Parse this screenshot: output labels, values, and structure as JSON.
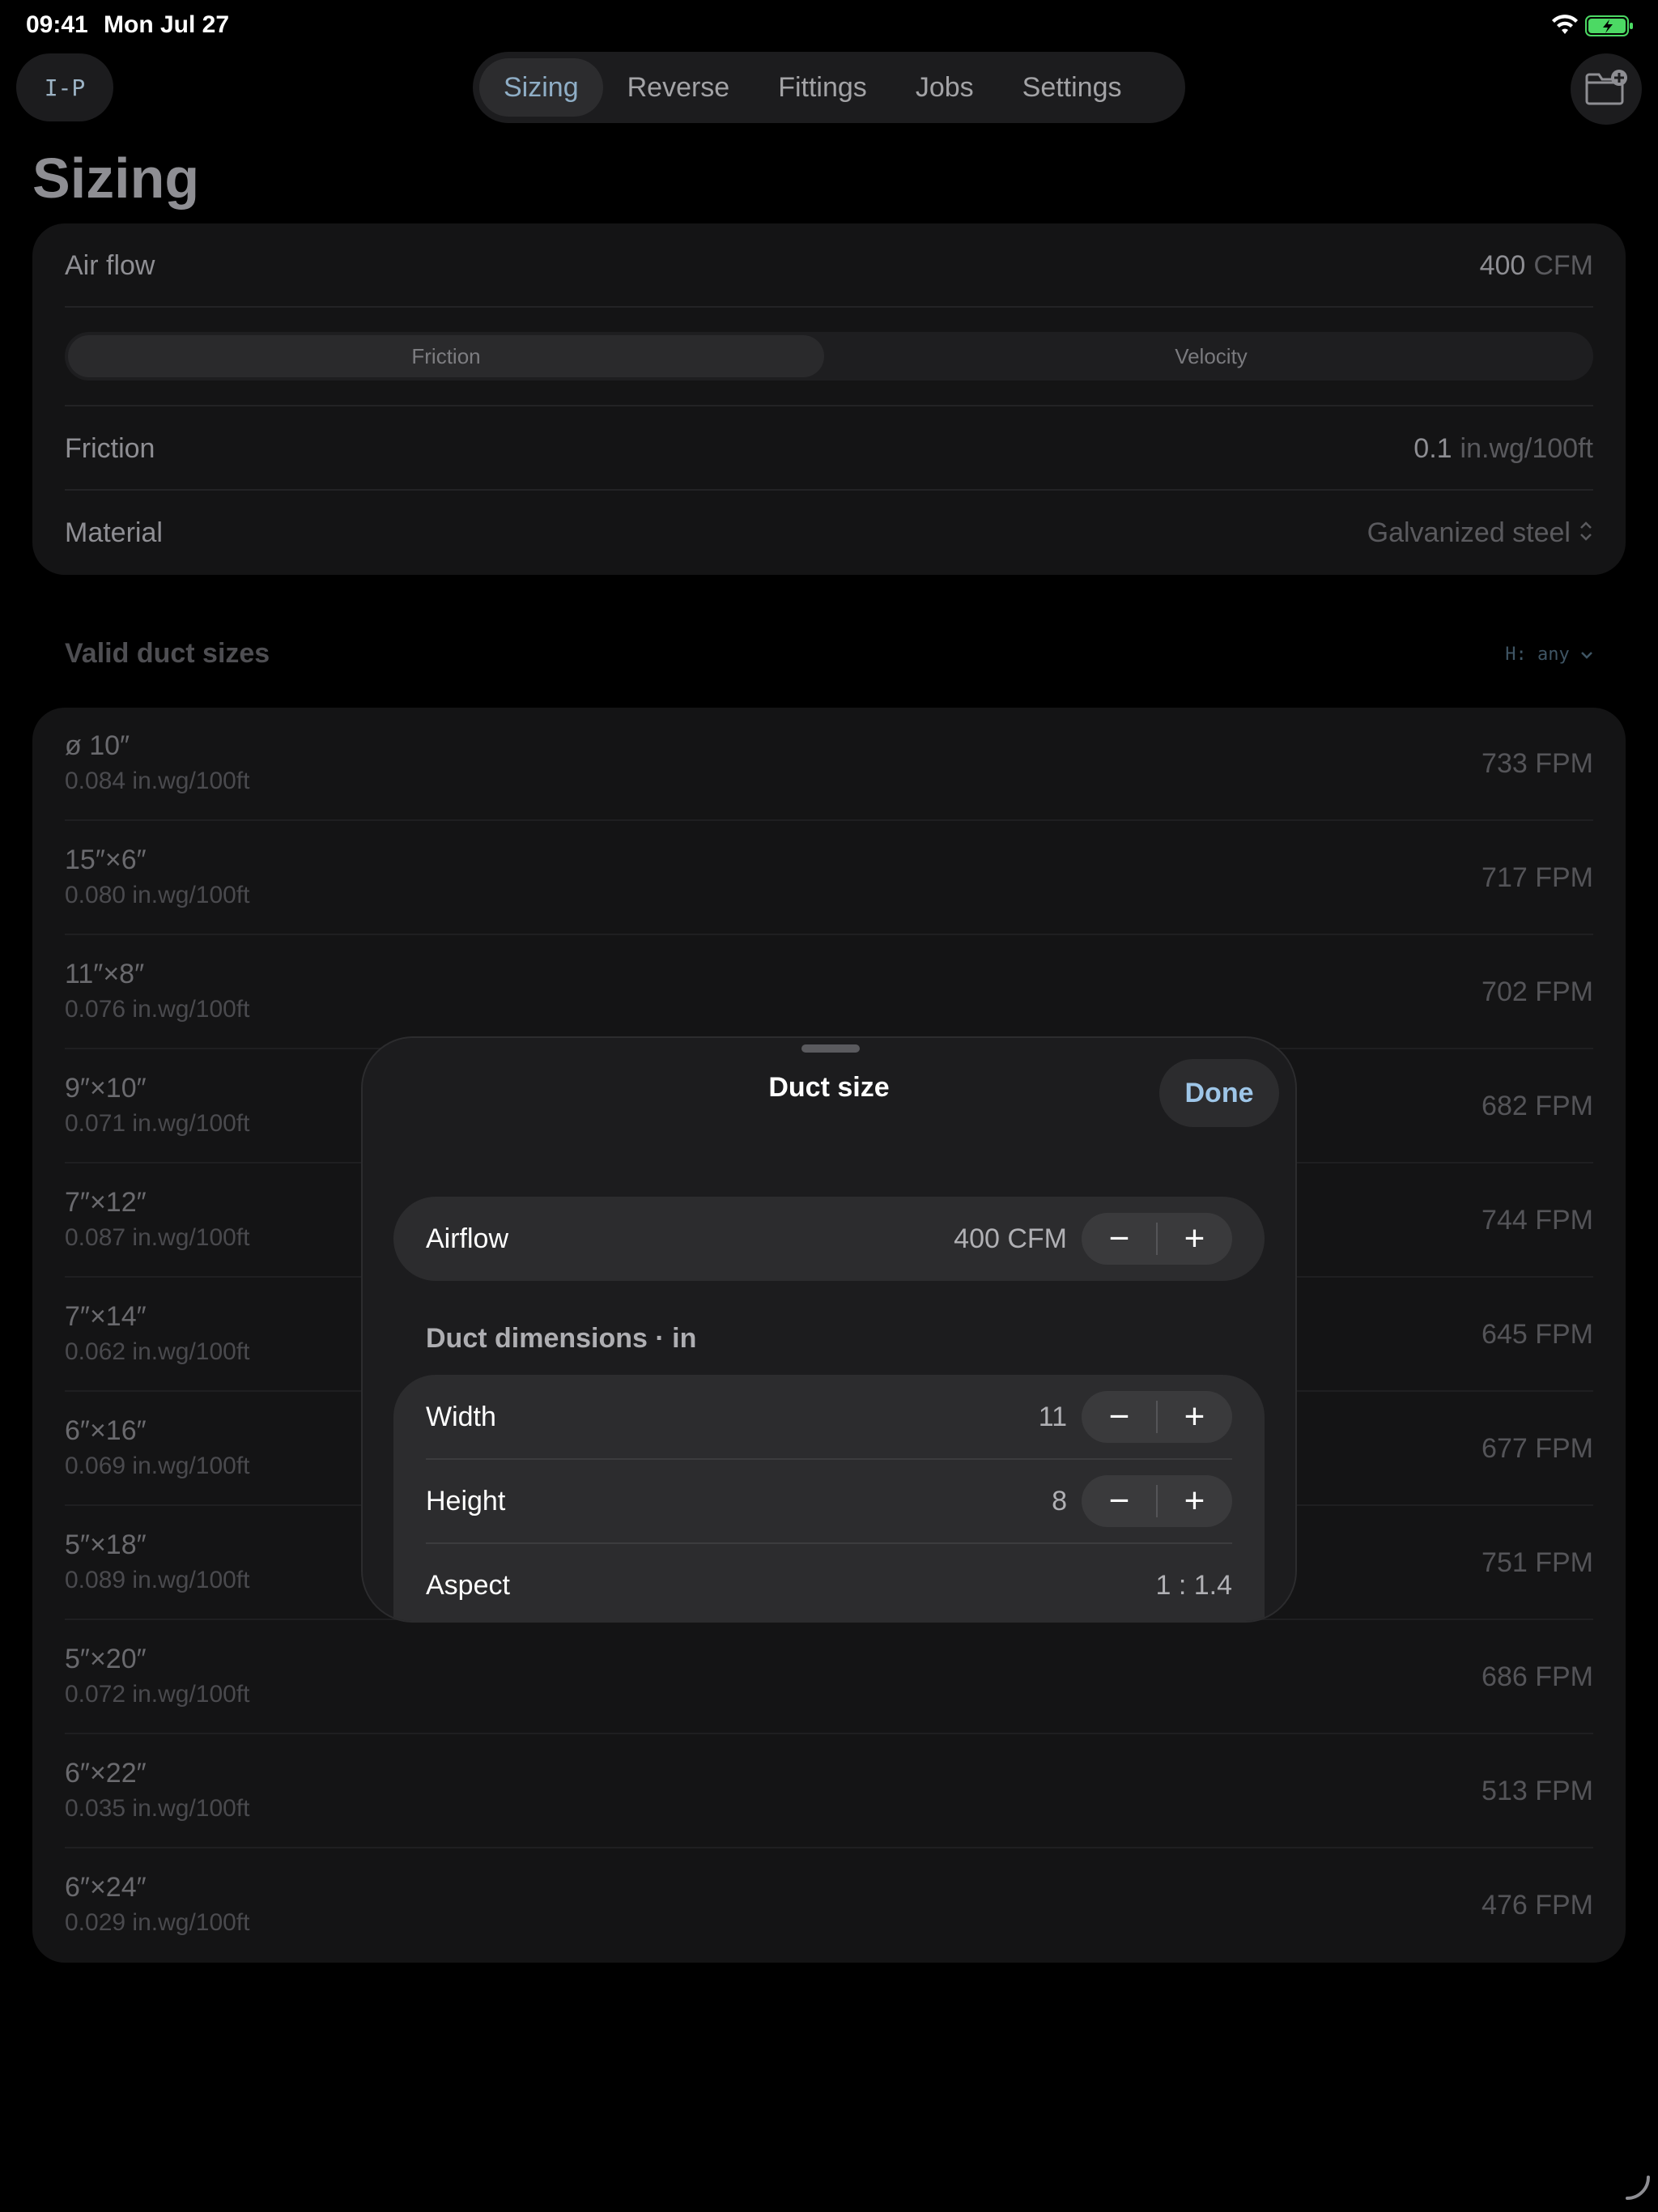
{
  "status": {
    "time": "09:41",
    "date": "Mon Jul 27"
  },
  "topbar": {
    "unit_button": "I-P",
    "tabs": [
      "Sizing",
      "Reverse",
      "Fittings",
      "Jobs",
      "Settings"
    ],
    "active_tab": "Sizing",
    "folder_icon": "folder-add-icon"
  },
  "page": {
    "title": "Sizing"
  },
  "form": {
    "airflow": {
      "label": "Air flow",
      "value": "400",
      "unit": "CFM"
    },
    "mode": {
      "options": [
        "Friction",
        "Velocity"
      ],
      "selected": "Friction"
    },
    "friction": {
      "label": "Friction",
      "value": "0.1",
      "unit": "in.wg/100ft"
    },
    "material": {
      "label": "Material",
      "value": "Galvanized steel"
    }
  },
  "sizes": {
    "title": "Valid duct sizes",
    "filter": "H: any",
    "items": [
      {
        "dim": "ø 10″",
        "friction": "0.084 in.wg/100ft",
        "velocity": "733 FPM"
      },
      {
        "dim": "15″×6″",
        "friction": "0.080 in.wg/100ft",
        "velocity": "717 FPM"
      },
      {
        "dim": "11″×8″",
        "friction": "0.076 in.wg/100ft",
        "velocity": "702 FPM"
      },
      {
        "dim": "9″×10″",
        "friction": "0.071 in.wg/100ft",
        "velocity": "682 FPM"
      },
      {
        "dim": "7″×12″",
        "friction": "0.087 in.wg/100ft",
        "velocity": "744 FPM"
      },
      {
        "dim": "7″×14″",
        "friction": "0.062 in.wg/100ft",
        "velocity": "645 FPM"
      },
      {
        "dim": "6″×16″",
        "friction": "0.069 in.wg/100ft",
        "velocity": "677 FPM"
      },
      {
        "dim": "5″×18″",
        "friction": "0.089 in.wg/100ft",
        "velocity": "751 FPM"
      },
      {
        "dim": "5″×20″",
        "friction": "0.072 in.wg/100ft",
        "velocity": "686 FPM"
      },
      {
        "dim": "6″×22″",
        "friction": "0.035 in.wg/100ft",
        "velocity": "513 FPM"
      },
      {
        "dim": "6″×24″",
        "friction": "0.029 in.wg/100ft",
        "velocity": "476 FPM"
      }
    ]
  },
  "sheet": {
    "title": "Duct size",
    "done": "Done",
    "airflow": {
      "label": "Airflow",
      "value": "400 CFM"
    },
    "dims_header": "Duct dimensions · in",
    "width": {
      "label": "Width",
      "value": "11"
    },
    "height": {
      "label": "Height",
      "value": "8"
    },
    "aspect": {
      "label": "Aspect",
      "value": "1 : 1.4"
    },
    "minus": "−",
    "plus": "+"
  }
}
